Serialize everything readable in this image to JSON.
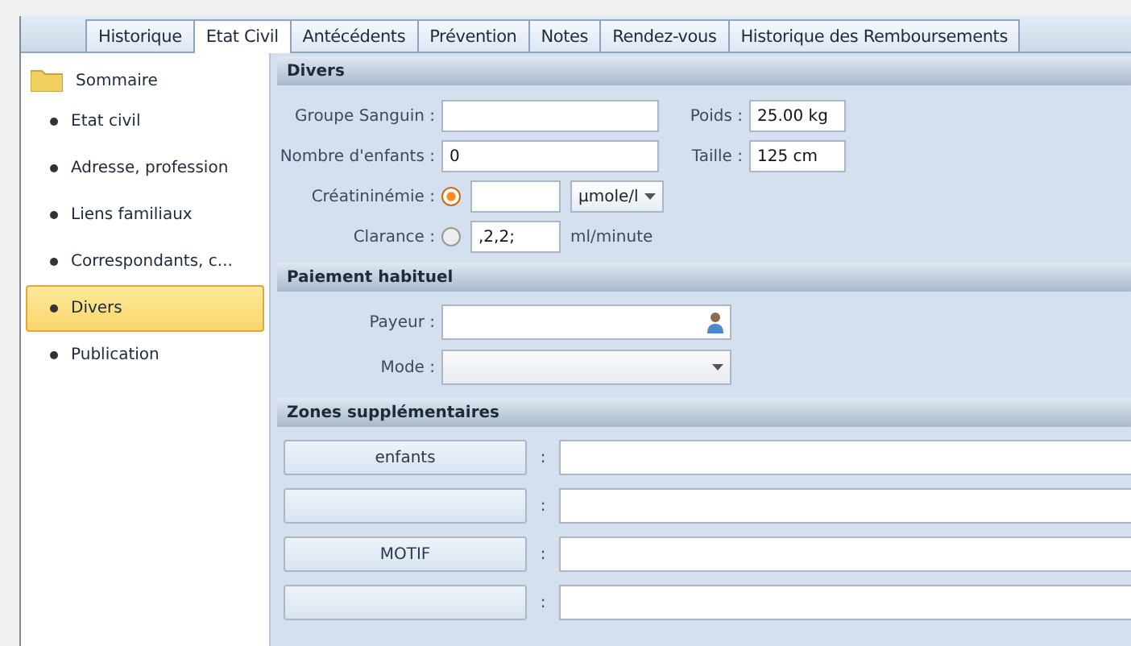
{
  "tabs": [
    {
      "label": "Historique",
      "selected": false
    },
    {
      "label": "Etat Civil",
      "selected": true
    },
    {
      "label": "Antécédents",
      "selected": false
    },
    {
      "label": "Prévention",
      "selected": false
    },
    {
      "label": "Notes",
      "selected": false
    },
    {
      "label": "Rendez-vous",
      "selected": false
    },
    {
      "label": "Historique des Remboursements",
      "selected": false
    }
  ],
  "sidebar": {
    "root": "Sommaire",
    "items": [
      {
        "label": "Etat civil",
        "selected": false
      },
      {
        "label": "Adresse, profession",
        "selected": false
      },
      {
        "label": "Liens familiaux",
        "selected": false
      },
      {
        "label": "Correspondants, c...",
        "selected": false
      },
      {
        "label": "Divers",
        "selected": true
      },
      {
        "label": "Publication",
        "selected": false
      }
    ]
  },
  "divers": {
    "title": "Divers",
    "groupe_sanguin": {
      "label": "Groupe Sanguin :"
    },
    "poids": {
      "label": "Poids :",
      "value": "25.00 kg"
    },
    "nombre_enfants": {
      "label": "Nombre d'enfants :",
      "value": "0"
    },
    "taille": {
      "label": "Taille :",
      "value": "125 cm"
    },
    "creatininemie": {
      "label": "Créatininémie :",
      "selected": true,
      "unit": "µmole/l"
    },
    "clarance": {
      "label": "Clarance :",
      "selected": false,
      "value": ",2,2;",
      "unit": "ml/minute"
    }
  },
  "paiement": {
    "title": "Paiement habituel",
    "payeur": {
      "label": "Payeur :"
    },
    "mode": {
      "label": "Mode  :"
    }
  },
  "zones": {
    "title": "Zones supplémentaires",
    "rows": [
      {
        "label": "enfants",
        "separator": ":"
      },
      {
        "separator": ":"
      },
      {
        "label": "MOTIF",
        "separator": ":"
      },
      {
        "separator": ":"
      }
    ]
  }
}
